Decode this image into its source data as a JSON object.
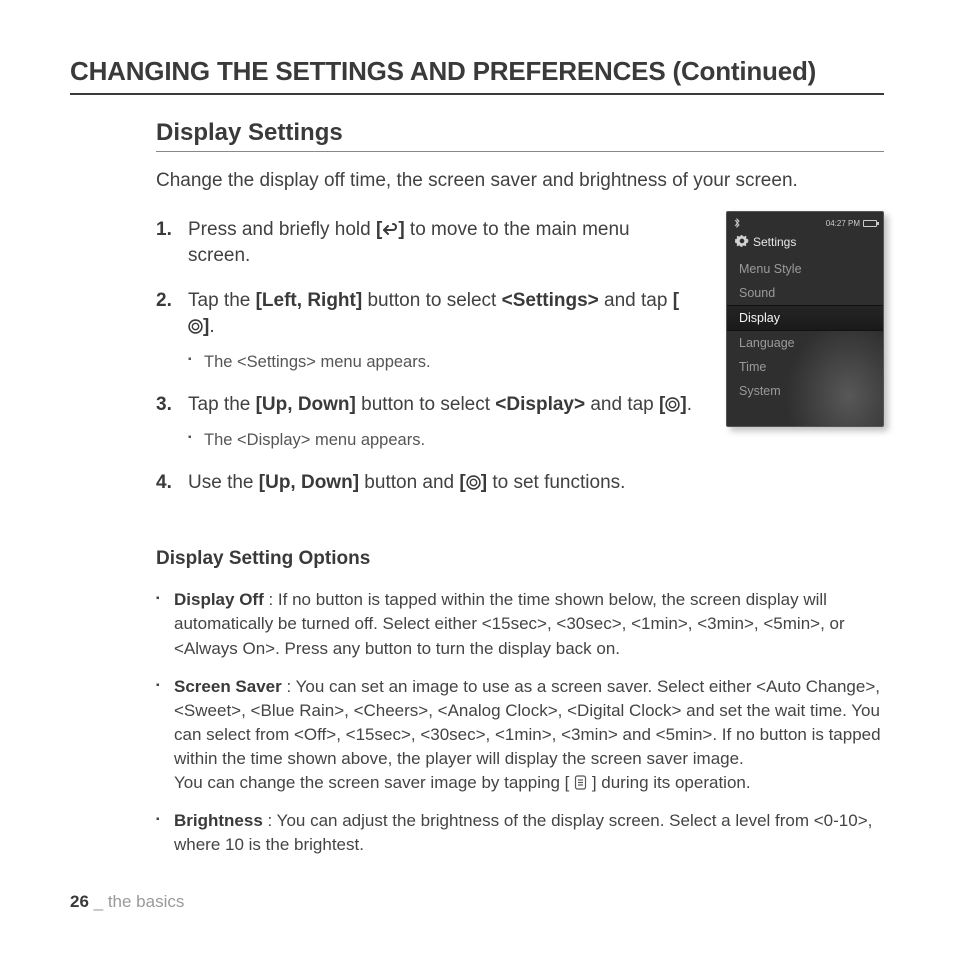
{
  "page_title": "CHANGING THE SETTINGS AND PREFERENCES (Continued)",
  "section_title": "Display Settings",
  "intro": "Change the display off time, the screen saver and brightness of your screen.",
  "steps": [
    {
      "num": "1.",
      "pre": "Press and briefly hold ",
      "br_open": "[",
      "icon": "back",
      "br_close": "]",
      "post": " to move to the main menu screen.",
      "sub": ""
    },
    {
      "num": "2.",
      "pre": "Tap the ",
      "bold1": "[Left, Right]",
      "mid1": " button to select ",
      "bold2": "<Settings>",
      "mid2": " and tap ",
      "br_open": "[",
      "icon": "center",
      "br_close": "]",
      "post": ".",
      "sub": "The <Settings> menu appears."
    },
    {
      "num": "3.",
      "pre": "Tap the ",
      "bold1": "[Up, Down]",
      "mid1": " button to select ",
      "bold2": "<Display>",
      "mid2": " and tap ",
      "br_open": "[",
      "icon": "center",
      "br_close": "]",
      "post": ".",
      "sub": "The <Display> menu appears."
    },
    {
      "num": "4.",
      "pre": "Use the ",
      "bold1": "[Up, Down]",
      "mid1": " button and ",
      "br_open": "[",
      "icon": "center",
      "br_close": "]",
      "post": " to set functions.",
      "sub": ""
    }
  ],
  "options_title": "Display Setting Options",
  "options": [
    {
      "name": "Display Off",
      "sep": " : ",
      "desc": "If no button is tapped within the time shown below, the screen display will automatically be turned off. Select either <15sec>, <30sec>, <1min>, <3min>, <5min>, or <Always On>. Press any button to turn the display back on."
    },
    {
      "name": "Screen Saver",
      "sep": " : ",
      "desc": "You can set an image to use as a screen saver. Select either <Auto Change>, <Sweet>, <Blue Rain>, <Cheers>, <Analog Clock>, <Digital Clock> and set the wait time. You can select from <Off>, <15sec>, <30sec>, <1min>, <3min> and <5min>. If no button is tapped within the time shown above, the player will display the screen saver image.",
      "desc2_pre": "You can change the screen saver image by tapping [ ",
      "desc2_post": " ] during its operation."
    },
    {
      "name": "Brightness",
      "sep": " : ",
      "desc": "You can adjust the brightness of the display screen. Select a level from <0-10>, where 10 is the brightest."
    }
  ],
  "device": {
    "time": "04:27 PM",
    "header": "Settings",
    "items": [
      "Menu Style",
      "Sound",
      "Display",
      "Language",
      "Time",
      "System"
    ],
    "selected_index": 2
  },
  "footer": {
    "page": "26",
    "sep": " _ ",
    "chapter": "the basics"
  }
}
